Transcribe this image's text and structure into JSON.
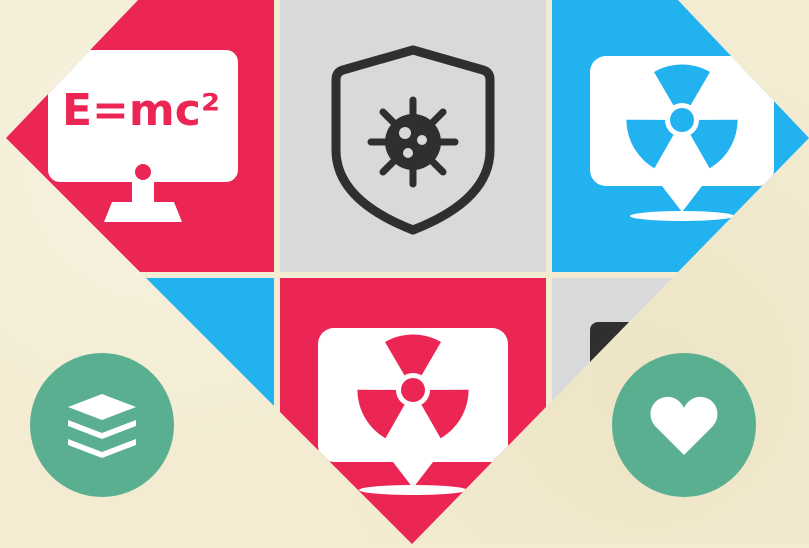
{
  "tiles": {
    "equation_tile": {
      "text": "E=mc²",
      "bg": "#ec2654"
    },
    "virus_shield_tile": {
      "bg": "#d7d9da"
    },
    "radiation_tile_blue": {
      "bg": "#22b2f0"
    },
    "radiation_tile_red": {
      "bg": "#ec2654"
    },
    "corner_tile_blue": {
      "bg": "#22b2f0"
    },
    "corner_tile_gray": {
      "bg": "#d7d9da"
    }
  },
  "buttons": {
    "layers": {
      "icon": "layers-icon",
      "color": "#5aaf91"
    },
    "favorite": {
      "icon": "heart-icon",
      "color": "#5aaf91"
    }
  },
  "colors": {
    "background": "#f3ecd2",
    "pink": "#ec2654",
    "blue": "#22b2f0",
    "gray": "#d7d9da",
    "green": "#5aaf91"
  }
}
